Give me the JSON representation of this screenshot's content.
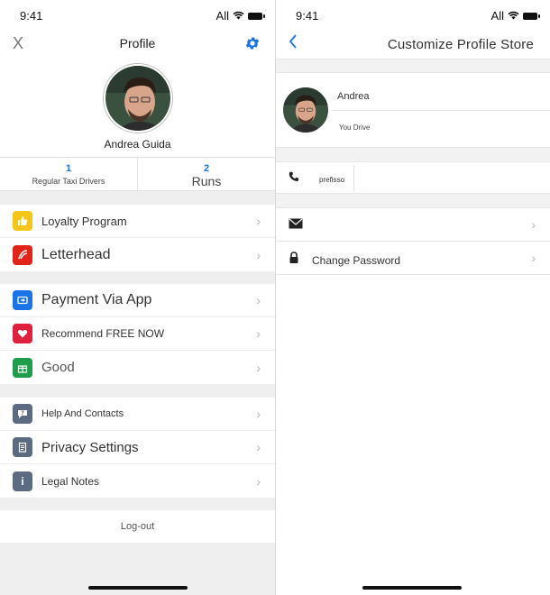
{
  "left": {
    "status": {
      "time": "9:41",
      "carrier": "All"
    },
    "header": {
      "close": "X",
      "title": "Profile"
    },
    "profile": {
      "name": "Andrea Guida"
    },
    "stats": [
      {
        "value": "1",
        "label": "Regular Taxi Drivers"
      },
      {
        "value": "2",
        "label": "Runs"
      }
    ],
    "groups": [
      [
        {
          "icon": "thumbs-up-icon",
          "color": "#f5c518",
          "label": "Loyalty Program"
        },
        {
          "icon": "train-icon",
          "color": "#e2231a",
          "label": "Letterhead"
        }
      ],
      [
        {
          "icon": "payment-app-icon",
          "color": "#1a73e8",
          "label": "Payment Via App"
        },
        {
          "icon": "heart-icon",
          "color": "#e0213d",
          "label": "Recommend FREE NOW"
        },
        {
          "icon": "gift-icon",
          "color": "#1e9e4a",
          "label": "Good"
        }
      ],
      [
        {
          "icon": "help-icon",
          "color": "#5d6b82",
          "label": "Help And Contacts"
        },
        {
          "icon": "clipboard-icon",
          "color": "#5d6b82",
          "label": "Privacy Settings"
        },
        {
          "icon": "info-icon",
          "color": "#5d6b82",
          "label": "Legal Notes"
        }
      ]
    ],
    "logout": "Log-out"
  },
  "right": {
    "status": {
      "time": "9:41",
      "carrier": "All"
    },
    "header": {
      "title": "Customize Profile Store"
    },
    "profile": {
      "name": "Andrea",
      "subtitle": "You Drive"
    },
    "phone": {
      "prefix": "prefisso"
    },
    "rows": [
      {
        "icon": "envelope-icon",
        "label": ""
      },
      {
        "icon": "lock-icon",
        "label": "Change Password"
      }
    ]
  },
  "colors": {
    "accent": "#1a73e8"
  }
}
